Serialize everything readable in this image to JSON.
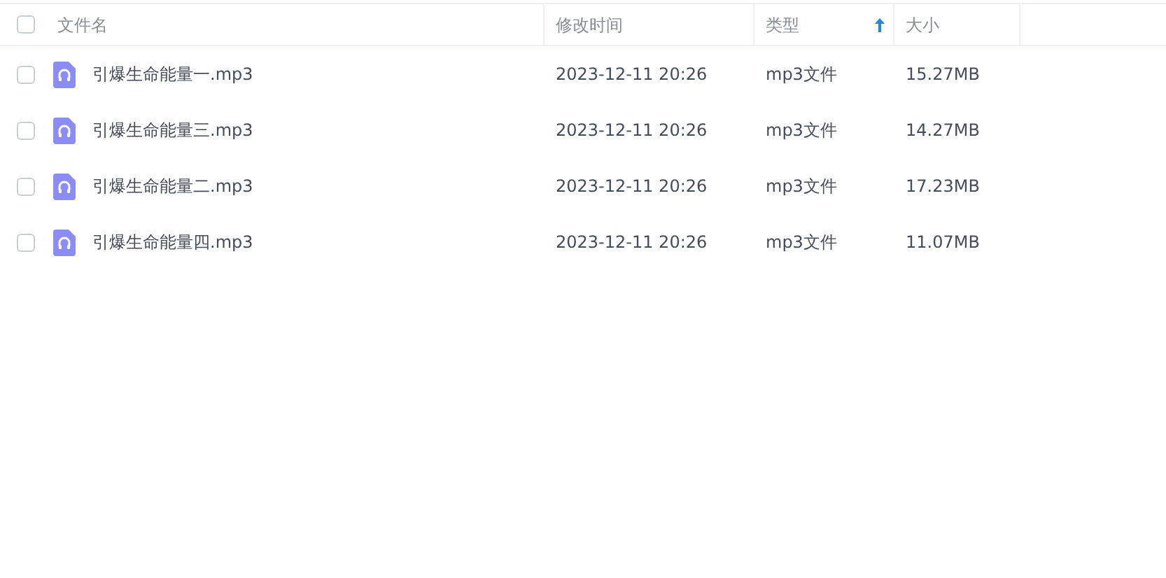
{
  "table": {
    "select_all": {
      "checked": false
    },
    "columns": [
      {
        "label": "文件名",
        "sorted": false
      },
      {
        "label": "修改时间",
        "sorted": false
      },
      {
        "label": "类型",
        "sorted": true
      },
      {
        "label": "大小",
        "sorted": false
      }
    ],
    "rows": [
      {
        "checked": false,
        "name": "引爆生命能量一.mp3",
        "modified": "2023-12-11 20:26",
        "type": "mp3文件",
        "size": "15.27MB"
      },
      {
        "checked": false,
        "name": "引爆生命能量三.mp3",
        "modified": "2023-12-11 20:26",
        "type": "mp3文件",
        "size": "14.27MB"
      },
      {
        "checked": false,
        "name": "引爆生命能量二.mp3",
        "modified": "2023-12-11 20:26",
        "type": "mp3文件",
        "size": "17.23MB"
      },
      {
        "checked": false,
        "name": "引爆生命能量四.mp3",
        "modified": "2023-12-11 20:26",
        "type": "mp3文件",
        "size": "11.07MB"
      }
    ]
  }
}
